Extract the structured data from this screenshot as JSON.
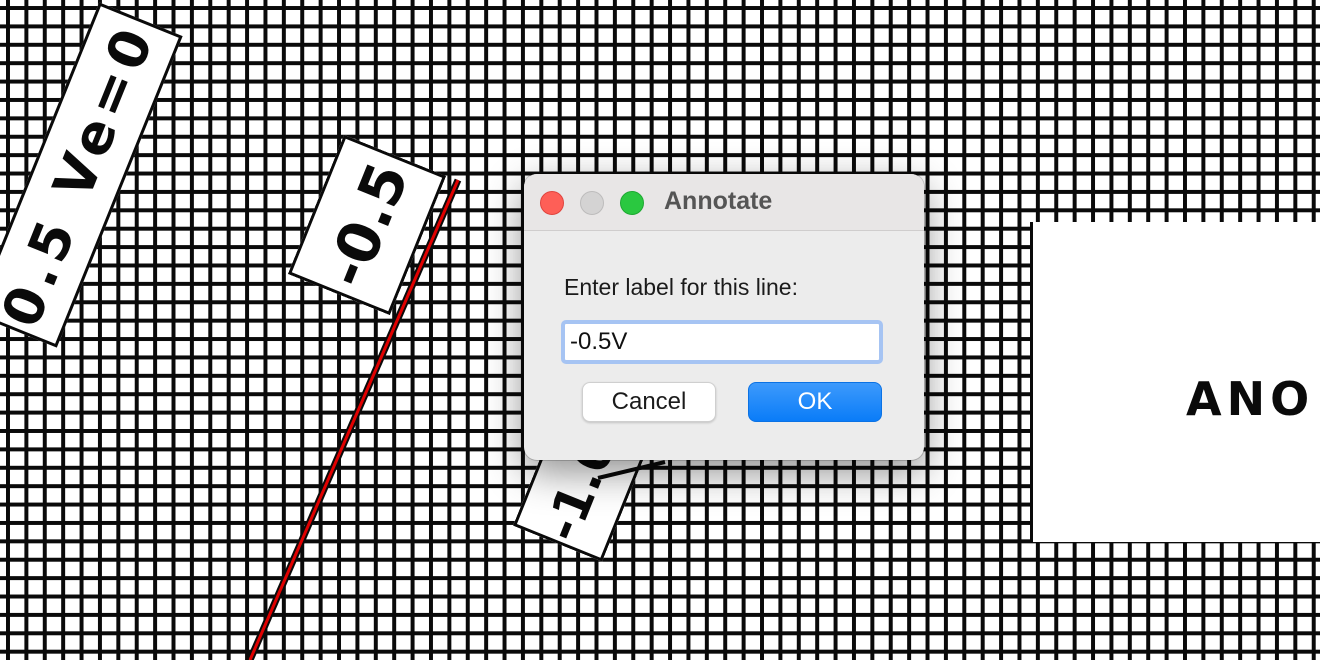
{
  "background": {
    "label_big": "0.5 Ve=0",
    "label_05": "-0.5",
    "label_10": "-1.0",
    "panel_text": "ANO",
    "line_color": "#e00000"
  },
  "dialog": {
    "title": "Annotate",
    "prompt": "Enter label for this line:",
    "input_value": "-0.5V",
    "cancel_label": "Cancel",
    "ok_label": "OK",
    "accent": "#0a7cf8"
  },
  "icons": {
    "close": "close-icon",
    "minimize": "minimize-icon",
    "zoom": "zoom-icon"
  }
}
